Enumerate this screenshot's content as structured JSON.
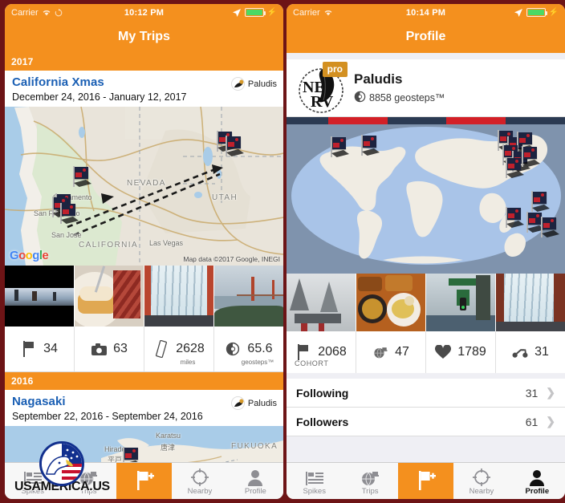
{
  "theme": {
    "orange": "#F4901E",
    "frame": "#6D1416",
    "link_blue": "#1A5FB4",
    "battery_green": "#4CD964",
    "pro_gold": "#D39021"
  },
  "left_phone": {
    "statusbar": {
      "carrier": "Carrier",
      "wifi_icon": "wifi-icon",
      "sync_icon": "sync-icon",
      "time": "10:12 PM",
      "location_icon": "location-arrow-icon",
      "battery_icon": "battery-icon",
      "charging_icon": "charging-bolt-icon"
    },
    "navbar": {
      "title": "My Trips"
    },
    "sections": [
      {
        "year": "2017",
        "trip": {
          "title": "California Xmas",
          "dates": "December 24, 2016 - January 12, 2017",
          "owner": "Paludis",
          "owner_avatar_icon": "user-avatar-icon",
          "map": {
            "labels": [
              {
                "text": "NEVADA",
                "type": "state"
              },
              {
                "text": "UTAH",
                "type": "state"
              },
              {
                "text": "CALIFORNIA",
                "type": "state"
              },
              {
                "text": "Sacramento",
                "type": "city"
              },
              {
                "text": "San Francisco",
                "type": "city"
              },
              {
                "text": "San Jose",
                "type": "city"
              },
              {
                "text": "Las Vegas",
                "type": "city"
              }
            ],
            "logo": "Google",
            "attribution": "Map data ©2017 Google, INEGI"
          },
          "photos": [
            "photo-night-scene",
            "photo-pancakes-bacon",
            "photo-bridge-cables",
            "photo-golden-gate"
          ],
          "stats": [
            {
              "icon": "flag-icon",
              "value": "34",
              "unit": ""
            },
            {
              "icon": "camera-icon",
              "value": "63",
              "unit": ""
            },
            {
              "icon": "ruler-icon",
              "value": "2628",
              "unit": "miles"
            },
            {
              "icon": "geosteps-icon",
              "value": "65.6",
              "unit": "geosteps™"
            }
          ]
        }
      },
      {
        "year": "2016",
        "trip": {
          "title": "Nagasaki",
          "dates": "September 22, 2016 - September 24, 2016",
          "owner": "Paludis",
          "owner_avatar_icon": "user-avatar-icon",
          "map": {
            "labels": [
              {
                "text": "Karatsu",
                "type": "city"
              },
              {
                "text": "唐津",
                "type": "city"
              },
              {
                "text": "Hirado",
                "type": "city"
              },
              {
                "text": "平戸",
                "type": "city"
              },
              {
                "text": "FUKUOKA",
                "type": "state"
              }
            ],
            "logo": "",
            "attribution": ""
          }
        }
      }
    ],
    "tabbar": [
      {
        "label": "Spikes",
        "icon": "spikes-list-icon",
        "state": "inactive"
      },
      {
        "label": "Trips",
        "icon": "globe-hat-icon",
        "state": "inactive"
      },
      {
        "label": "",
        "icon": "add-flag-icon",
        "state": "center"
      },
      {
        "label": "Nearby",
        "icon": "compass-icon",
        "state": "inactive"
      },
      {
        "label": "Profile",
        "icon": "person-icon",
        "state": "inactive"
      }
    ]
  },
  "right_phone": {
    "statusbar": {
      "carrier": "Carrier",
      "wifi_icon": "wifi-icon",
      "sync_icon": "",
      "time": "10:14 PM",
      "location_icon": "location-arrow-icon",
      "battery_icon": "battery-icon",
      "charging_icon": "charging-bolt-icon"
    },
    "navbar": {
      "title": "Profile"
    },
    "profile": {
      "avatar_icon": "nerv-logo-icon",
      "pro_badge": "pro",
      "name": "Paludis",
      "geosteps_icon": "geosteps-icon",
      "geosteps": "8858 geosteps™"
    },
    "world_map": {
      "flag_icon": "flag-pin-icon",
      "flag_count": 13
    },
    "photos": [
      "photo-snow-shrine",
      "photo-ramen-bowls",
      "photo-street-signs",
      "photo-bridge-cables"
    ],
    "stats": [
      {
        "icon": "flag-icon",
        "value": "2068",
        "unit": "COHORT"
      },
      {
        "icon": "globe-hat-icon",
        "value": "47",
        "unit": ""
      },
      {
        "icon": "heart-icon",
        "value": "1789",
        "unit": ""
      },
      {
        "icon": "scooter-icon",
        "value": "31",
        "unit": ""
      }
    ],
    "rows": [
      {
        "label": "Following",
        "count": "31",
        "chevron": "chevron-right-icon"
      },
      {
        "label": "Followers",
        "count": "61",
        "chevron": "chevron-right-icon"
      }
    ],
    "tabbar": [
      {
        "label": "Spikes",
        "icon": "spikes-list-icon",
        "state": "inactive"
      },
      {
        "label": "Trips",
        "icon": "globe-hat-icon",
        "state": "inactive"
      },
      {
        "label": "",
        "icon": "add-flag-icon",
        "state": "center"
      },
      {
        "label": "Nearby",
        "icon": "compass-icon",
        "state": "inactive"
      },
      {
        "label": "Profile",
        "icon": "person-icon",
        "state": "active"
      }
    ]
  },
  "watermark": {
    "text": "USAMERICA.US",
    "icon": "eagle-flag-icon"
  }
}
